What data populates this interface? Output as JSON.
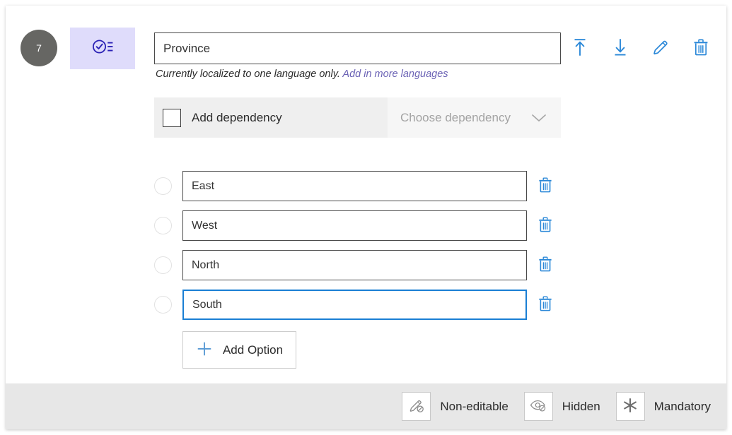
{
  "field": {
    "order_number": "7",
    "type_icon": "single-select-list-icon",
    "title_value": "Province",
    "title_placeholder": "Field name",
    "localization_note": "Currently localized to one language only.",
    "localization_link": "Add in more languages"
  },
  "title_actions": [
    {
      "name": "move-to-top-icon",
      "label": "Move to top"
    },
    {
      "name": "move-down-icon",
      "label": "Move down"
    },
    {
      "name": "edit-pencil-icon",
      "label": "Edit"
    },
    {
      "name": "delete-trash-icon",
      "label": "Delete"
    }
  ],
  "dependency": {
    "checkbox_checked": false,
    "label": "Add dependency",
    "select_placeholder": "Choose dependency",
    "chevron_icon": "chevron-down-icon"
  },
  "options": {
    "items": [
      {
        "value": "East",
        "focused": false
      },
      {
        "value": "West",
        "focused": false
      },
      {
        "value": "North",
        "focused": false
      },
      {
        "value": "South",
        "focused": true
      }
    ],
    "delete_icon": "trash-icon",
    "add_button_label": "Add Option",
    "add_button_icon": "plus-icon"
  },
  "footer": {
    "flags": [
      {
        "icon": "pencil-slash-icon",
        "label": "Non-editable"
      },
      {
        "icon": "eye-slash-icon",
        "label": "Hidden"
      },
      {
        "icon": "asterisk-icon",
        "label": "Mandatory"
      }
    ]
  },
  "colors": {
    "accent_blue": "#2b88d8",
    "tile_purple": "#dfdcfb",
    "icon_indigo": "#2a21b5",
    "link_purple": "#6b63b5",
    "badge_grey": "#666663",
    "band_grey": "#efefef",
    "footer_grey": "#e7e7e7",
    "focus_blue": "#1a7fd4"
  }
}
